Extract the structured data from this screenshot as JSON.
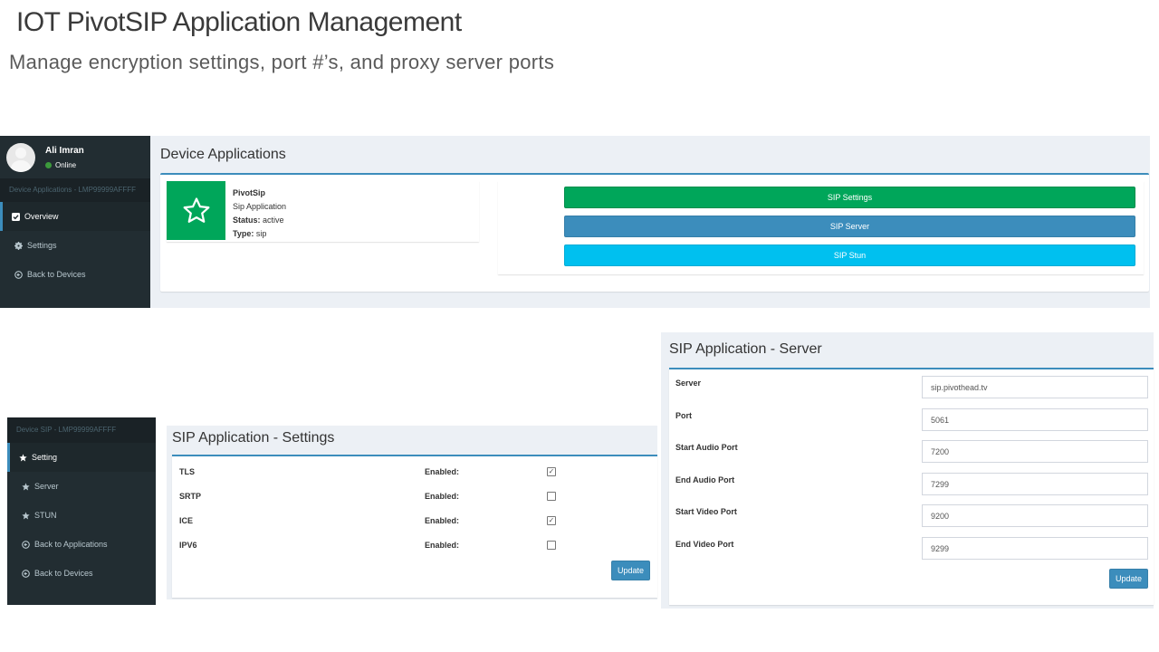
{
  "slide": {
    "title": "IOT PivotSIP Application Management",
    "subtitle": "Manage encryption settings, port #’s, and proxy server ports"
  },
  "panel1": {
    "user": {
      "name": "Ali Imran",
      "status": "Online"
    },
    "sidebar": {
      "header": "Device Applications - LMP99999AFFFF",
      "items": [
        {
          "label": "Overview",
          "icon": "check-square-icon",
          "active": true
        },
        {
          "label": "Settings",
          "icon": "gear-icon",
          "active": false
        },
        {
          "label": "Back to Devices",
          "icon": "arrow-circle-left-icon",
          "active": false
        }
      ]
    },
    "heading": "Device Applications",
    "app": {
      "name": "PivotSip",
      "description": "Sip Application",
      "status_label": "Status:",
      "status_value": "active",
      "type_label": "Type:",
      "type_value": "sip"
    },
    "buttons": {
      "settings": "SIP Settings",
      "server": "SIP Server",
      "stun": "SIP Stun"
    },
    "colors": {
      "green": "#00a65a",
      "blue": "#3c8dbc",
      "cyan": "#00c0ef",
      "sidebar": "#222d32"
    }
  },
  "panel2": {
    "sidebar": {
      "header": "Device SIP - LMP99999AFFFF",
      "items": [
        {
          "label": "Setting",
          "icon": "star-icon",
          "active": true
        },
        {
          "label": "Server",
          "icon": "star-icon",
          "active": false
        },
        {
          "label": "STUN",
          "icon": "star-icon",
          "active": false
        },
        {
          "label": "Back to Applications",
          "icon": "arrow-circle-left-icon",
          "active": false
        },
        {
          "label": "Back to Devices",
          "icon": "arrow-circle-left-icon",
          "active": false
        }
      ]
    },
    "heading": "SIP Application - Settings",
    "enabled_label": "Enabled:",
    "rows": [
      {
        "name": "TLS",
        "checked": true
      },
      {
        "name": "SRTP",
        "checked": false
      },
      {
        "name": "ICE",
        "checked": true
      },
      {
        "name": "IPV6",
        "checked": false
      }
    ],
    "update_label": "Update"
  },
  "panel3": {
    "heading": "SIP Application - Server",
    "fields": [
      {
        "label": "Server",
        "value": "sip.pivothead.tv"
      },
      {
        "label": "Port",
        "value": "5061"
      },
      {
        "label": "Start Audio Port",
        "value": "7200"
      },
      {
        "label": "End Audio Port",
        "value": "7299"
      },
      {
        "label": "Start Video Port",
        "value": "9200"
      },
      {
        "label": "End Video Port",
        "value": "9299"
      }
    ],
    "update_label": "Update"
  }
}
